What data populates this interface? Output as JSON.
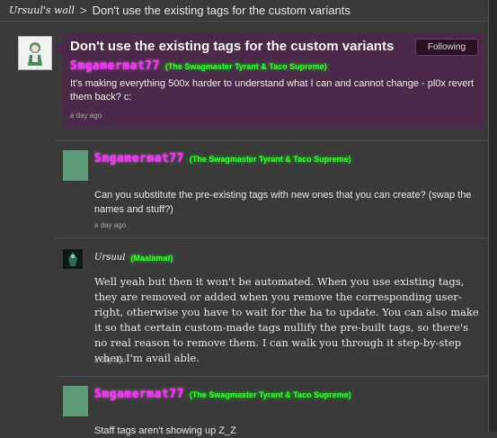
{
  "breadcrumb": {
    "wall": "Ursuul's wall",
    "separator": ">",
    "title": "Don't use the existing tags for the custom variants"
  },
  "thread": {
    "title": "Don't use the existing tags for the custom variants",
    "follow_label": "Following",
    "author": "Smgamermat77",
    "author_tag": "(The Swagmaster Tyrant & Taco Supreme)",
    "body": "It's making everything 500x harder to understand what I can and cannot change - pl0x revert them back? c:",
    "timestamp": "a day ago"
  },
  "replies": [
    {
      "author": "Smgamermat77",
      "author_tag": "(The Swagmaster Tyrant & Taco Supreme)",
      "body": "Can you substitute the pre-existing tags with new ones that you can create? (swap the names and stuff?)",
      "timestamp": "a day ago"
    },
    {
      "author": "Ursuul",
      "author_tag": "(Maalamat)",
      "body": "Well yeah but then it won't be automated. When you use existing tags, they are removed or added when you remove the corresponding user-right, otherwise you have to wait for the ha to update. You can also make it so that certain custom-made tags nullify the pre-built tags, so there's no real reason to remove them. I can walk you through it step-by-step when I'm avail able.",
      "timestamp": "a day ago"
    },
    {
      "author": "Smgamermat77",
      "author_tag": "(The Swagmaster Tyrant & Taco Supreme)",
      "body": "Staff tags aren't showing up Z_Z",
      "timestamp": ""
    }
  ],
  "colors": {
    "background": "#3a3a3a",
    "first_post_bg": "#4a2a48",
    "username": "#ff33ff",
    "tag": "#33ff33",
    "avatar": "#5f9a78"
  }
}
